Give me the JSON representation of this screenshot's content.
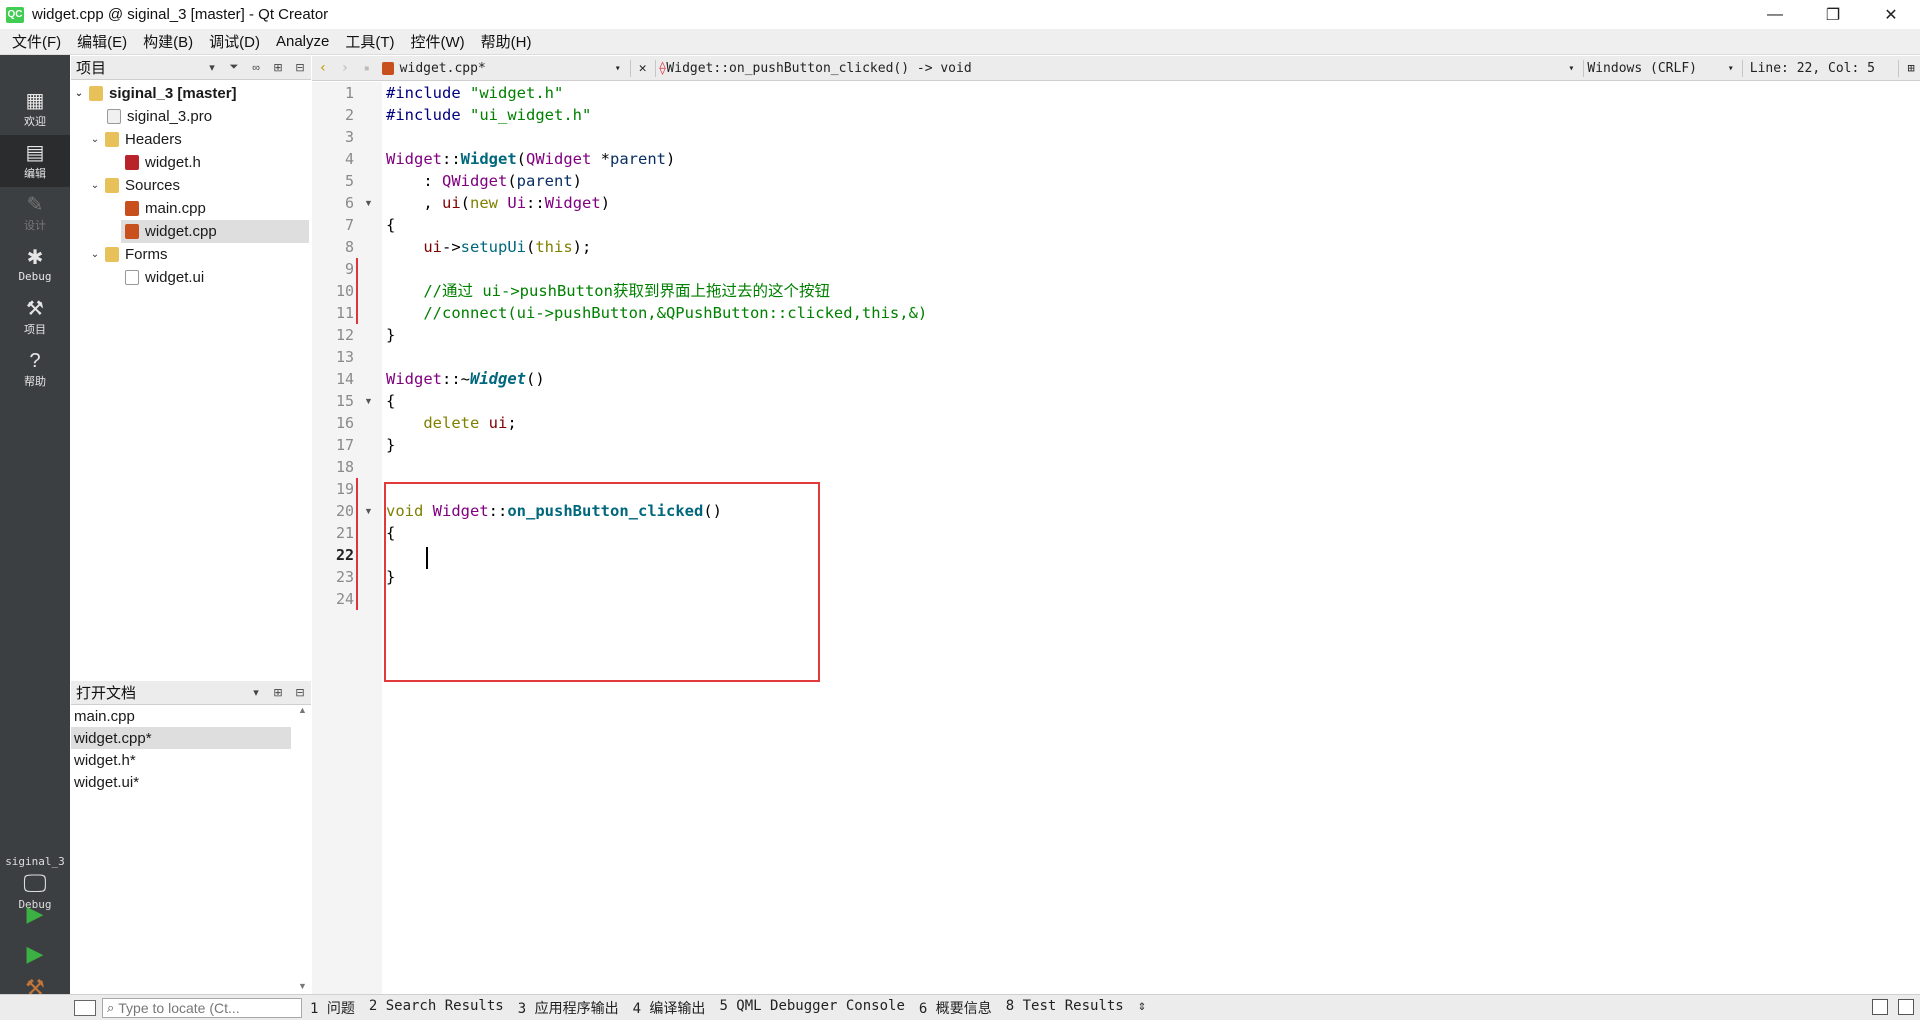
{
  "window": {
    "title": "widget.cpp @ siginal_3 [master] - Qt Creator",
    "app_icon": "QC",
    "minimize": "—",
    "maximize": "❐",
    "close": "✕"
  },
  "menu": [
    "文件(F)",
    "编辑(E)",
    "构建(B)",
    "调试(D)",
    "Analyze",
    "工具(T)",
    "控件(W)",
    "帮助(H)"
  ],
  "modes": [
    {
      "label": "欢迎",
      "icon": "grid-icon"
    },
    {
      "label": "编辑",
      "icon": "edit-icon"
    },
    {
      "label": "设计",
      "icon": "pencil-icon"
    },
    {
      "label": "Debug",
      "icon": "bug-icon"
    },
    {
      "label": "项目",
      "icon": "wrench-icon"
    },
    {
      "label": "帮助",
      "icon": "help-icon"
    }
  ],
  "kit": {
    "project": "siginal_3",
    "config": "Debug"
  },
  "projects_pane": {
    "title": "项目",
    "tree": [
      {
        "label": "siginal_3 [master]",
        "type": "project-root"
      },
      {
        "label": "siginal_3.pro",
        "type": "pro"
      },
      {
        "label": "Headers",
        "type": "folder"
      },
      {
        "label": "widget.h",
        "type": "header"
      },
      {
        "label": "Sources",
        "type": "folder"
      },
      {
        "label": "main.cpp",
        "type": "cpp"
      },
      {
        "label": "widget.cpp",
        "type": "cpp",
        "selected": true
      },
      {
        "label": "Forms",
        "type": "folder"
      },
      {
        "label": "widget.ui",
        "type": "ui"
      }
    ]
  },
  "open_docs": {
    "title": "打开文档",
    "items": [
      "main.cpp",
      "widget.cpp*",
      "widget.h*",
      "widget.ui*"
    ]
  },
  "editor_toolbar": {
    "file": "widget.cpp*",
    "symbol": "Widget::on_pushButton_clicked() -> void",
    "line_ending": "Windows (CRLF)",
    "position": "Line: 22, Col: 5"
  },
  "editor": {
    "current_line": 22,
    "line_numbers": [
      "1",
      "2",
      "3",
      "4",
      "5",
      "6",
      "7",
      "8",
      "9",
      "10",
      "11",
      "12",
      "13",
      "14",
      "15",
      "16",
      "17",
      "18",
      "19",
      "20",
      "21",
      "22",
      "23",
      "24"
    ]
  },
  "statusbar": {
    "locator_placeholder": "Type to locate (Ct...",
    "panes": [
      "1 问题",
      "2 Search Results",
      "3 应用程序输出",
      "4 编译输出",
      "5 QML Debugger Console",
      "6 概要信息",
      "8 Test Results"
    ]
  },
  "colors": {
    "accent_red": "#e23a3a",
    "sidebar": "#3c3f41"
  }
}
